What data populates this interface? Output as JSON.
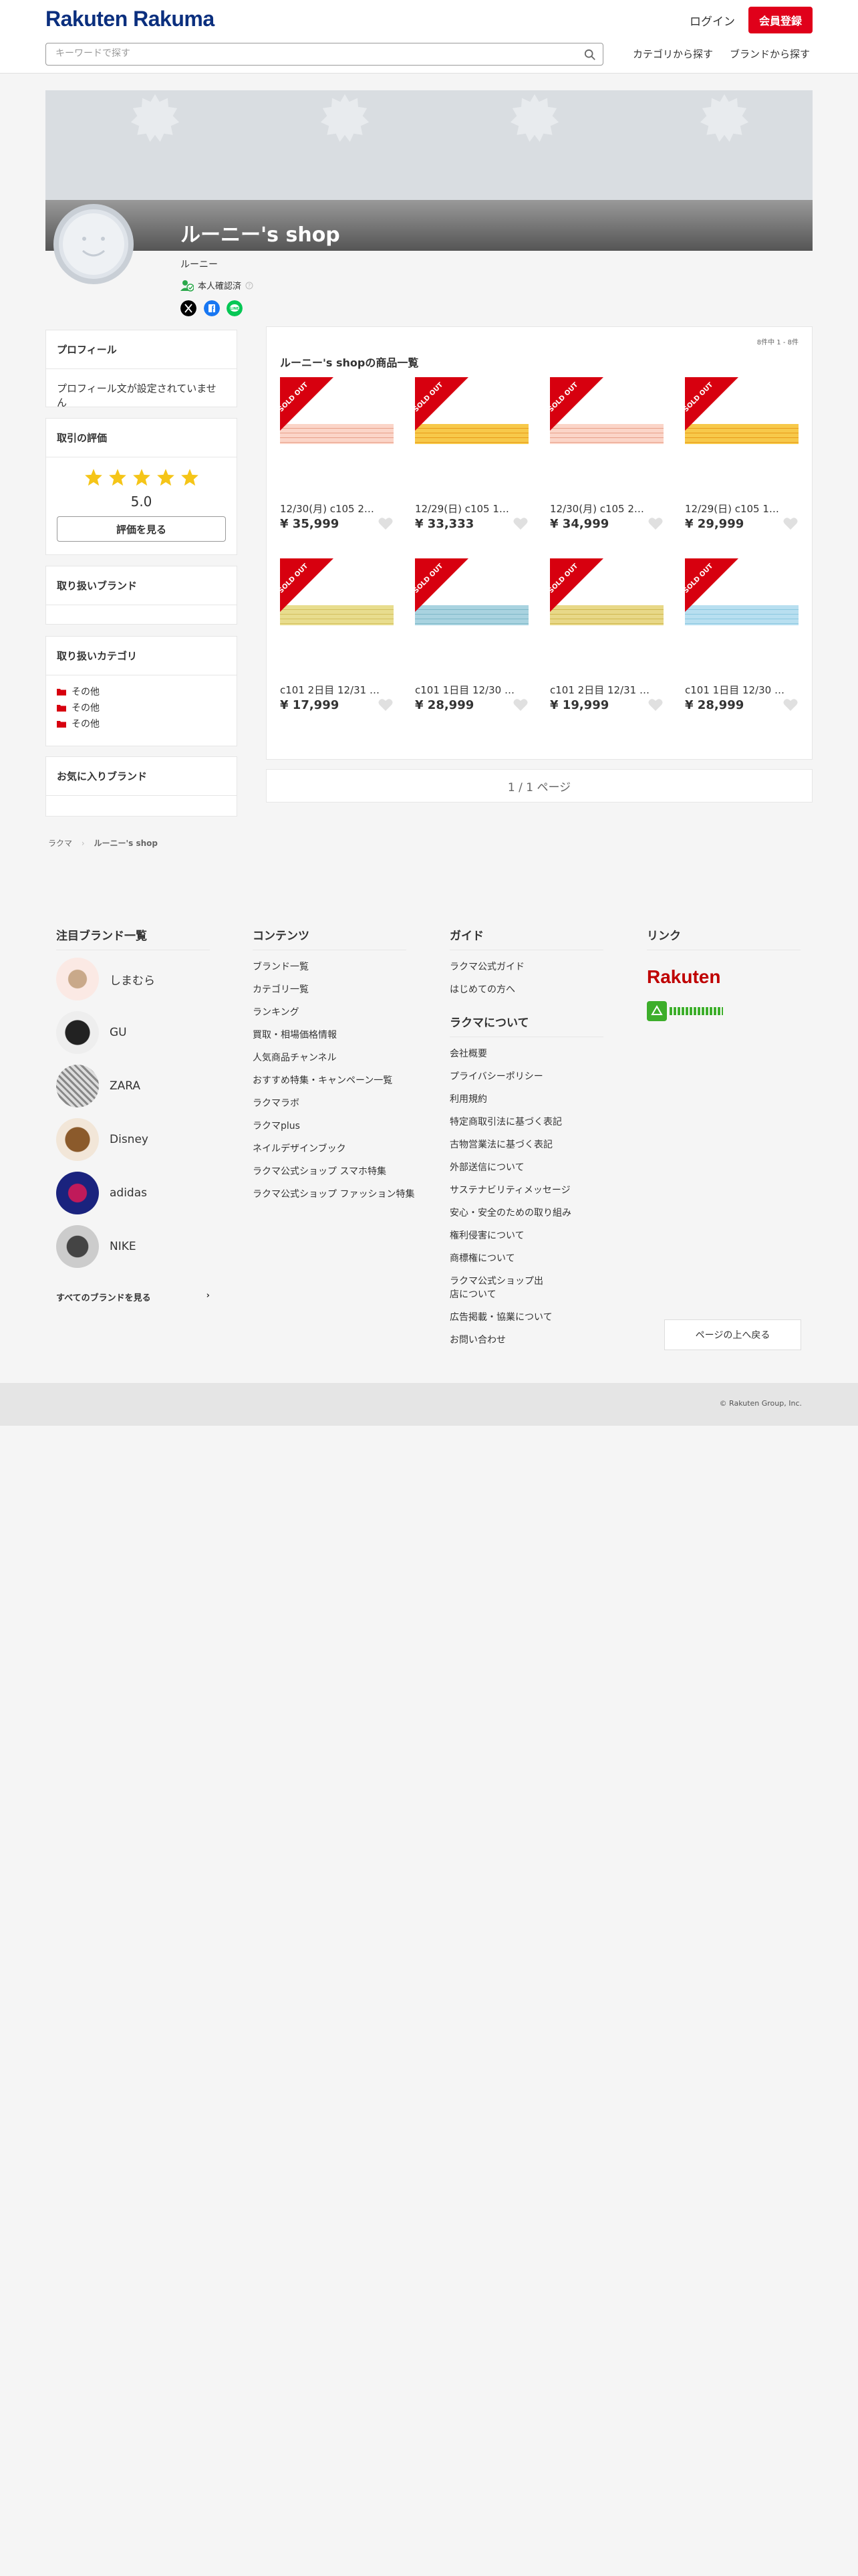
{
  "header": {
    "logo": "Rakuten Rakuma",
    "login": "ログイン",
    "register": "会員登録",
    "search_placeholder": "キーワードで探す",
    "nav_category": "カテゴリから探す",
    "nav_brand": "ブランドから探す"
  },
  "shop": {
    "title": "ルーニー's shop",
    "owner": "ルーニー",
    "verified": "本人確認済"
  },
  "profile": {
    "heading": "プロフィール",
    "text": "プロフィール文が設定されていません"
  },
  "rating": {
    "heading": "取引の評価",
    "score": "5.0",
    "stars": 5,
    "button": "評価を見る"
  },
  "brands_handled": {
    "heading": "取り扱いブランド"
  },
  "categories": {
    "heading": "取り扱いカテゴリ",
    "items": [
      "その他",
      "その他",
      "その他"
    ]
  },
  "favorite_brands": {
    "heading": "お気に入りブランド"
  },
  "products": {
    "heading": "ルーニー's shopの商品一覧",
    "count": "8件中 1 - 8件",
    "sold_label": "SOLD OUT",
    "items": [
      {
        "name": "12/30(月) c105 2日...",
        "price": "¥ 35,999"
      },
      {
        "name": "12/29(日) c105 1日...",
        "price": "¥ 33,333"
      },
      {
        "name": "12/30(月) c105 2日...",
        "price": "¥ 34,999"
      },
      {
        "name": "12/29(日) c105 1日...",
        "price": "¥ 29,999"
      },
      {
        "name": "c101 2日目 12/31 コ...",
        "price": "¥ 17,999"
      },
      {
        "name": "c101 1日目 12/30 コ...",
        "price": "¥ 28,999"
      },
      {
        "name": "c101 2日目 12/31 コ...",
        "price": "¥ 19,999"
      },
      {
        "name": "c101 1日目 12/30 コ...",
        "price": "¥ 28,999"
      }
    ]
  },
  "pager": "1 / 1 ページ",
  "breadcrumb": {
    "home": "ラクマ",
    "current": "ルーニー's shop"
  },
  "footer": {
    "brands_heading": "注目ブランド一覧",
    "brands": [
      "しまむら",
      "GU",
      "ZARA",
      "Disney",
      "adidas",
      "NIKE"
    ],
    "all_brands": "すべてのブランドを見る",
    "contents_heading": "コンテンツ",
    "contents": [
      "ブランド一覧",
      "カテゴリ一覧",
      "ランキング",
      "買取・相場価格情報",
      "人気商品チャンネル",
      "おすすめ特集・キャンペーン一覧",
      "ラクマラボ",
      "ラクマplus",
      "ネイルデザインブック",
      "ラクマ公式ショップ スマホ特集",
      "ラクマ公式ショップ ファッション特集"
    ],
    "guide_heading": "ガイド",
    "guide": [
      "ラクマ公式ガイド",
      "はじめての方へ"
    ],
    "about_heading": "ラクマについて",
    "about": [
      "会社概要",
      "プライバシーポリシー",
      "利用規約",
      "特定商取引法に基づく表記",
      "古物営業法に基づく表記",
      "外部送信について",
      "サステナビリティメッセージ",
      "安心・安全のための取り組み",
      "権利侵害について",
      "商標権について",
      "ラクマ公式ショップ出店について",
      "広告掲載・協業について",
      "お問い合わせ"
    ],
    "links_heading": "リンク",
    "rakuten_logo": "Rakuten",
    "totop": "ページの上へ戻る",
    "copyright": "© Rakuten Group, Inc."
  },
  "colors": {
    "brand_red": "#e0001a",
    "star": "#f5c518",
    "logo_blue": "#0b2f7e"
  }
}
